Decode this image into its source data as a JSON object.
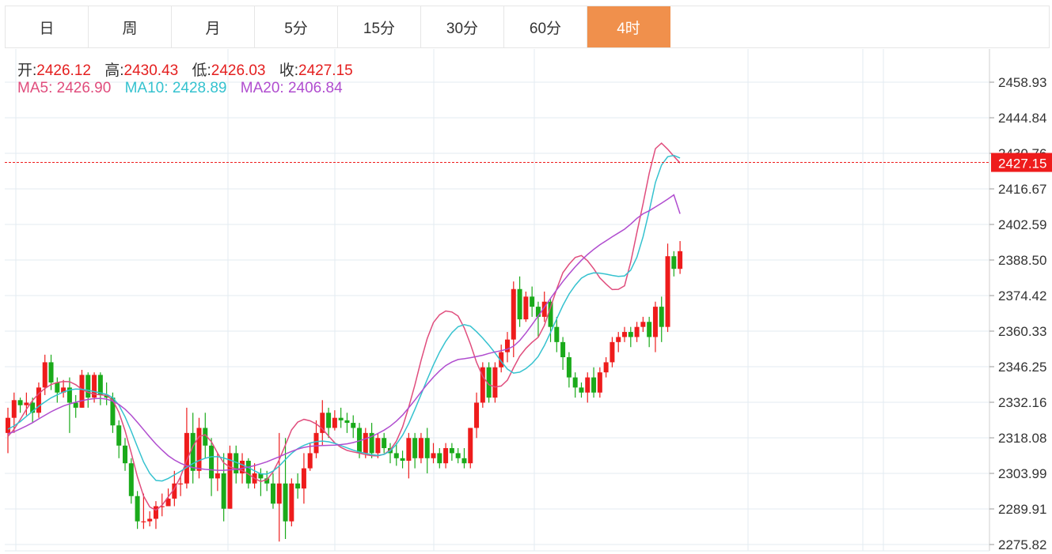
{
  "tabs": [
    {
      "label": "日",
      "active": false
    },
    {
      "label": "周",
      "active": false
    },
    {
      "label": "月",
      "active": false
    },
    {
      "label": "5分",
      "active": false
    },
    {
      "label": "15分",
      "active": false
    },
    {
      "label": "30分",
      "active": false
    },
    {
      "label": "60分",
      "active": false
    },
    {
      "label": "4时",
      "active": true
    }
  ],
  "ohlc_info": {
    "open_label": "开:",
    "open": "2426.12",
    "high_label": "高:",
    "high": "2430.43",
    "low_label": "低:",
    "low": "2426.03",
    "close_label": "收:",
    "close": "2427.15"
  },
  "ma_info": {
    "ma5_label": "MA5:",
    "ma5": "2426.90",
    "ma10_label": "MA10:",
    "ma10": "2428.89",
    "ma20_label": "MA20:",
    "ma20": "2406.84"
  },
  "colors": {
    "up": "#ee1c1c",
    "down": "#1aaa1a",
    "ma5": "#e04d7d",
    "ma10": "#35c2cf",
    "ma20": "#b04dcf",
    "accent": "#f0904c",
    "last_price_bg": "#ee1c1c"
  },
  "chart_data": {
    "type": "candlestick",
    "y_ticks": [
      "2458.93",
      "2444.84",
      "2430.76",
      "2416.67",
      "2402.59",
      "2388.50",
      "2374.42",
      "2360.33",
      "2346.25",
      "2332.16",
      "2318.08",
      "2303.99",
      "2289.91",
      "2275.82"
    ],
    "ylim": [
      2275.82,
      2458.93
    ],
    "last_price": "2427.15",
    "grid": true,
    "series": [
      {
        "name": "MA5",
        "values": [
          2318.6,
          2321.5,
          2325.3,
          2329.4,
          2332.9,
          2335.6,
          2337.6,
          2339.2,
          2340.0,
          2340.4,
          2340.3,
          2339.1,
          2337.3,
          2336.1,
          2335.4,
          2335.1,
          2334.9,
          2333.0,
          2328.2,
          2320.9,
          2312.1,
          2302.6,
          2295.0,
          2290.7,
          2289.4,
          2291.4,
          2294.7,
          2297.9,
          2302.7,
          2309.2,
          2314.7,
          2318.6,
          2319.3,
          2316.5,
          2312.0,
          2308.2,
          2306.5,
          2305.8,
          2305.1,
          2303.7,
          2302.0,
          2300.8,
          2301.5,
          2304.6,
          2309.4,
          2315.3,
          2321.2,
          2324.3,
          2325.4,
          2324.8,
          2323.6,
          2321.6,
          2318.8,
          2316.1,
          2314.3,
          2313.1,
          2312.5,
          2312.0,
          2311.4,
          2311.0,
          2310.9,
          2311.6,
          2313.3,
          2316.8,
          2322.4,
          2330.3,
          2339.0,
          2348.7,
          2357.4,
          2363.7,
          2366.8,
          2368.3,
          2367.9,
          2366.3,
          2361.6,
          2355.2,
          2348.0,
          2342.4,
          2339.1,
          2338.2,
          2338.6,
          2340.9,
          2345.8,
          2350.4,
          2353.5,
          2355.9,
          2357.9,
          2362.6,
          2369.8,
          2377.0,
          2383.5,
          2386.8,
          2389.5,
          2390.3,
          2388.2,
          2385.1,
          2381.4,
          2379.0,
          2376.8,
          2376.9,
          2378.3,
          2387.7,
          2399.4,
          2410.8,
          2422.9,
          2432.6,
          2434.8,
          2432.4,
          2429.6,
          2426.9
        ]
      },
      {
        "name": "MA10",
        "values": [
          2321.5,
          2322.8,
          2324.5,
          2326.6,
          2328.6,
          2330.6,
          2332.3,
          2333.9,
          2335.1,
          2336.2,
          2337.0,
          2337.4,
          2337.3,
          2336.9,
          2336.4,
          2335.9,
          2335.3,
          2334.0,
          2331.0,
          2326.4,
          2320.7,
          2314.5,
          2308.5,
          2304.0,
          2301.2,
          2301.0,
          2302.0,
          2303.4,
          2304.8,
          2306.4,
          2307.9,
          2309.1,
          2310.0,
          2310.6,
          2310.6,
          2310.1,
          2309.3,
          2308.4,
          2307.4,
          2306.3,
          2305.0,
          2303.8,
          2303.7,
          2304.9,
          2306.9,
          2309.5,
          2311.9,
          2313.8,
          2315.1,
          2316.0,
          2316.6,
          2316.8,
          2316.5,
          2315.9,
          2315.0,
          2314.1,
          2313.2,
          2312.5,
          2311.9,
          2311.4,
          2311.1,
          2311.5,
          2312.9,
          2315.5,
          2319.1,
          2323.8,
          2329.3,
          2335.2,
          2341.2,
          2346.9,
          2352.0,
          2356.3,
          2359.7,
          2362.1,
          2362.9,
          2362.3,
          2360.1,
          2357.6,
          2354.8,
          2351.7,
          2348.3,
          2345.3,
          2343.7,
          2344.1,
          2345.5,
          2347.5,
          2350.3,
          2354.6,
          2359.8,
          2365.2,
          2370.5,
          2375.0,
          2378.5,
          2381.3,
          2382.7,
          2383.4,
          2383.3,
          2382.9,
          2382.4,
          2382.0,
          2382.2,
          2384.5,
          2389.6,
          2397.7,
          2408.0,
          2419.2,
          2426.1,
          2429.4,
          2429.9,
          2428.9
        ]
      },
      {
        "name": "MA20",
        "values": [
          2319.6,
          2320.5,
          2321.6,
          2322.8,
          2324.1,
          2325.6,
          2327.0,
          2328.4,
          2329.6,
          2330.7,
          2331.5,
          2332.2,
          2332.8,
          2333.3,
          2333.6,
          2333.7,
          2333.4,
          2332.6,
          2331.3,
          2329.4,
          2327.0,
          2324.2,
          2321.3,
          2318.4,
          2315.6,
          2313.2,
          2311.0,
          2309.3,
          2308.0,
          2307.0,
          2306.3,
          2305.9,
          2305.6,
          2305.4,
          2305.2,
          2305.2,
          2305.4,
          2305.6,
          2306.0,
          2306.5,
          2307.1,
          2307.8,
          2308.6,
          2309.6,
          2310.6,
          2311.7,
          2312.7,
          2313.6,
          2314.3,
          2314.7,
          2314.9,
          2315.0,
          2315.1,
          2315.2,
          2315.4,
          2315.7,
          2316.2,
          2316.9,
          2317.7,
          2318.6,
          2319.8,
          2321.1,
          2322.7,
          2324.7,
          2327.1,
          2330.0,
          2333.0,
          2336.2,
          2339.3,
          2342.1,
          2344.6,
          2346.7,
          2348.1,
          2349.1,
          2349.4,
          2349.8,
          2350.3,
          2350.8,
          2351.5,
          2352.1,
          2352.6,
          2353.2,
          2354.4,
          2356.6,
          2359.6,
          2362.9,
          2366.3,
          2369.8,
          2373.3,
          2376.7,
          2380.0,
          2383.0,
          2385.8,
          2388.4,
          2390.7,
          2392.7,
          2394.5,
          2396.1,
          2397.7,
          2399.2,
          2400.7,
          2402.7,
          2405.0,
          2406.8,
          2408.0,
          2409.5,
          2411.0,
          2412.6,
          2414.3,
          2406.8
        ]
      }
    ],
    "candles": [
      [
        2320,
        2326,
        2330,
        2312
      ],
      [
        2326,
        2333,
        2336,
        2320
      ],
      [
        2333,
        2331,
        2334,
        2328
      ],
      [
        2331,
        2332,
        2336,
        2327
      ],
      [
        2332,
        2328,
        2334,
        2324
      ],
      [
        2328,
        2338,
        2340,
        2326
      ],
      [
        2338,
        2348,
        2351,
        2335
      ],
      [
        2348,
        2340,
        2351,
        2337
      ],
      [
        2340,
        2336,
        2342,
        2332
      ],
      [
        2336,
        2338,
        2341,
        2334
      ],
      [
        2338,
        2332,
        2342,
        2320
      ],
      [
        2332,
        2330,
        2335,
        2326
      ],
      [
        2330,
        2343,
        2345,
        2330
      ],
      [
        2343,
        2334,
        2344,
        2330
      ],
      [
        2334,
        2343,
        2344,
        2332
      ],
      [
        2343,
        2335,
        2344,
        2331
      ],
      [
        2335,
        2334,
        2340,
        2331
      ],
      [
        2334,
        2323,
        2336,
        2320
      ],
      [
        2323,
        2315,
        2325,
        2310
      ],
      [
        2315,
        2308,
        2318,
        2305
      ],
      [
        2308,
        2295,
        2310,
        2292
      ],
      [
        2295,
        2285,
        2297,
        2282
      ],
      [
        2285,
        2285,
        2296,
        2282
      ],
      [
        2285,
        2286,
        2289,
        2283
      ],
      [
        2286,
        2291,
        2293,
        2282
      ],
      [
        2291,
        2291,
        2296,
        2287
      ],
      [
        2291,
        2294,
        2298,
        2291
      ],
      [
        2294,
        2300,
        2305,
        2291
      ],
      [
        2300,
        2300,
        2303,
        2295
      ],
      [
        2300,
        2320,
        2330,
        2298
      ],
      [
        2320,
        2305,
        2328,
        2300
      ],
      [
        2305,
        2322,
        2326,
        2302
      ],
      [
        2322,
        2315,
        2328,
        2310
      ],
      [
        2315,
        2302,
        2318,
        2295
      ],
      [
        2302,
        2304,
        2312,
        2297
      ],
      [
        2304,
        2290,
        2312,
        2285
      ],
      [
        2290,
        2312,
        2315,
        2290
      ],
      [
        2312,
        2304,
        2315,
        2300
      ],
      [
        2304,
        2309,
        2312,
        2300
      ],
      [
        2309,
        2300,
        2310,
        2298
      ],
      [
        2300,
        2304,
        2308,
        2298
      ],
      [
        2304,
        2302,
        2306,
        2295
      ],
      [
        2302,
        2300,
        2305,
        2297
      ],
      [
        2300,
        2292,
        2304,
        2290
      ],
      [
        2292,
        2300,
        2320,
        2277
      ],
      [
        2300,
        2285,
        2318,
        2278
      ],
      [
        2285,
        2300,
        2302,
        2283
      ],
      [
        2300,
        2298,
        2304,
        2294
      ],
      [
        2298,
        2306,
        2312,
        2292
      ],
      [
        2306,
        2312,
        2316,
        2305
      ],
      [
        2312,
        2320,
        2325,
        2310
      ],
      [
        2320,
        2328,
        2333,
        2315
      ],
      [
        2328,
        2322,
        2330,
        2318
      ],
      [
        2322,
        2326,
        2329,
        2321
      ],
      [
        2326,
        2325,
        2330,
        2322
      ],
      [
        2325,
        2324,
        2328,
        2320
      ],
      [
        2324,
        2322,
        2327,
        2318
      ],
      [
        2322,
        2312,
        2324,
        2310
      ],
      [
        2312,
        2320,
        2322,
        2310
      ],
      [
        2320,
        2312,
        2324,
        2310
      ],
      [
        2312,
        2318,
        2320,
        2310
      ],
      [
        2318,
        2314,
        2320,
        2312
      ],
      [
        2314,
        2312,
        2316,
        2308
      ],
      [
        2312,
        2310,
        2316,
        2307
      ],
      [
        2310,
        2309,
        2313,
        2306
      ],
      [
        2309,
        2318,
        2320,
        2302
      ],
      [
        2318,
        2310,
        2320,
        2306
      ],
      [
        2310,
        2318,
        2320,
        2308
      ],
      [
        2318,
        2310,
        2322,
        2304
      ],
      [
        2310,
        2312,
        2316,
        2308
      ],
      [
        2312,
        2308,
        2314,
        2306
      ],
      [
        2308,
        2314,
        2316,
        2306
      ],
      [
        2314,
        2312,
        2316,
        2309
      ],
      [
        2312,
        2310,
        2314,
        2308
      ],
      [
        2310,
        2308,
        2314,
        2306
      ],
      [
        2308,
        2322,
        2322,
        2306
      ],
      [
        2322,
        2332,
        2336,
        2318
      ],
      [
        2332,
        2346,
        2348,
        2330
      ],
      [
        2346,
        2334,
        2348,
        2332
      ],
      [
        2334,
        2346,
        2348,
        2332
      ],
      [
        2346,
        2352,
        2355,
        2344
      ],
      [
        2352,
        2357,
        2360,
        2348
      ],
      [
        2357,
        2377,
        2380,
        2350
      ],
      [
        2377,
        2365,
        2382,
        2362
      ],
      [
        2365,
        2374,
        2376,
        2364
      ],
      [
        2374,
        2370,
        2378,
        2366
      ],
      [
        2370,
        2366,
        2372,
        2358
      ],
      [
        2366,
        2372,
        2376,
        2364
      ],
      [
        2372,
        2362,
        2373,
        2356
      ],
      [
        2362,
        2356,
        2366,
        2352
      ],
      [
        2356,
        2350,
        2358,
        2345
      ],
      [
        2350,
        2342,
        2352,
        2338
      ],
      [
        2342,
        2338,
        2344,
        2334
      ],
      [
        2338,
        2336,
        2340,
        2334
      ],
      [
        2336,
        2342,
        2344,
        2332
      ],
      [
        2342,
        2336,
        2346,
        2334
      ],
      [
        2336,
        2344,
        2346,
        2334
      ],
      [
        2344,
        2348,
        2350,
        2342
      ],
      [
        2348,
        2356,
        2358,
        2346
      ],
      [
        2356,
        2358,
        2360,
        2352
      ],
      [
        2358,
        2360,
        2362,
        2356
      ],
      [
        2360,
        2358,
        2362,
        2354
      ],
      [
        2358,
        2362,
        2364,
        2356
      ],
      [
        2362,
        2364,
        2366,
        2360
      ],
      [
        2364,
        2358,
        2366,
        2354
      ],
      [
        2358,
        2370,
        2372,
        2352
      ],
      [
        2370,
        2362,
        2374,
        2356
      ],
      [
        2362,
        2390,
        2395,
        2360
      ],
      [
        2390,
        2385,
        2392,
        2382
      ],
      [
        2385,
        2392,
        2396,
        2383
      ]
    ]
  }
}
